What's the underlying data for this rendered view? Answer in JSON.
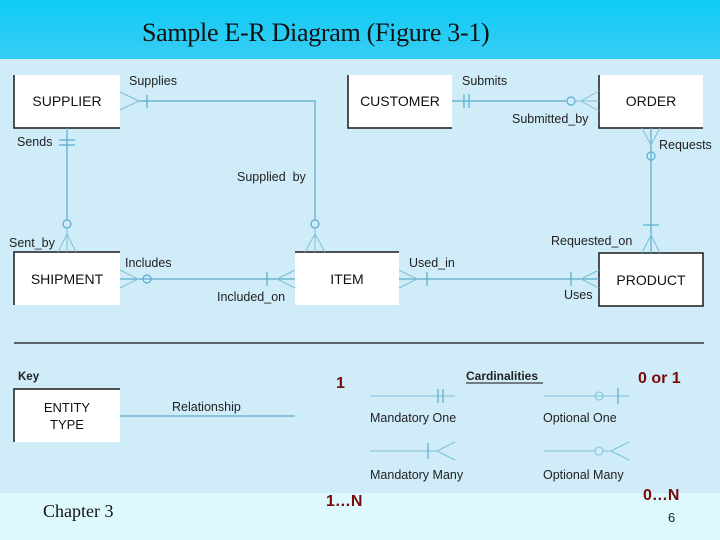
{
  "slide": {
    "title": "Sample E-R Diagram (Figure 3-1)",
    "footer_chapter": "Chapter 3",
    "page_number": "6"
  },
  "colors": {
    "title_bar": "#0ecbf6",
    "diagram_bg": "#cfecf8",
    "footer_bg": "#ddf9fd",
    "relationship_line": "#5aaccc",
    "annotation_red": "#7a0a0a"
  },
  "entities": {
    "supplier": "SUPPLIER",
    "customer": "CUSTOMER",
    "order": "ORDER",
    "shipment": "SHIPMENT",
    "item": "ITEM",
    "product": "PRODUCT"
  },
  "relationship_labels": {
    "supplies": "Supplies",
    "supplied_by": "Supplied  by",
    "sends": "Sends",
    "sent_by": "Sent_by",
    "submits": "Submits",
    "submitted_by": "Submitted_by",
    "requests": "Requests",
    "requested_on": "Requested_on",
    "includes": "Includes",
    "included_on": "Included_on",
    "used_in": "Used_in",
    "uses": "Uses"
  },
  "key": {
    "heading": "Key",
    "entity_line1": "ENTITY",
    "entity_line2": "TYPE",
    "relationship": "Relationship"
  },
  "cardinalities": {
    "heading": "Cardinalities",
    "mandatory_one": "Mandatory One",
    "optional_one": "Optional One",
    "mandatory_many": "Mandatory Many",
    "optional_many": "Optional Many"
  },
  "annotations": {
    "one": "1",
    "zero_or_one": "0 or 1",
    "one_to_n": "1…N",
    "zero_to_n": "0…N"
  }
}
